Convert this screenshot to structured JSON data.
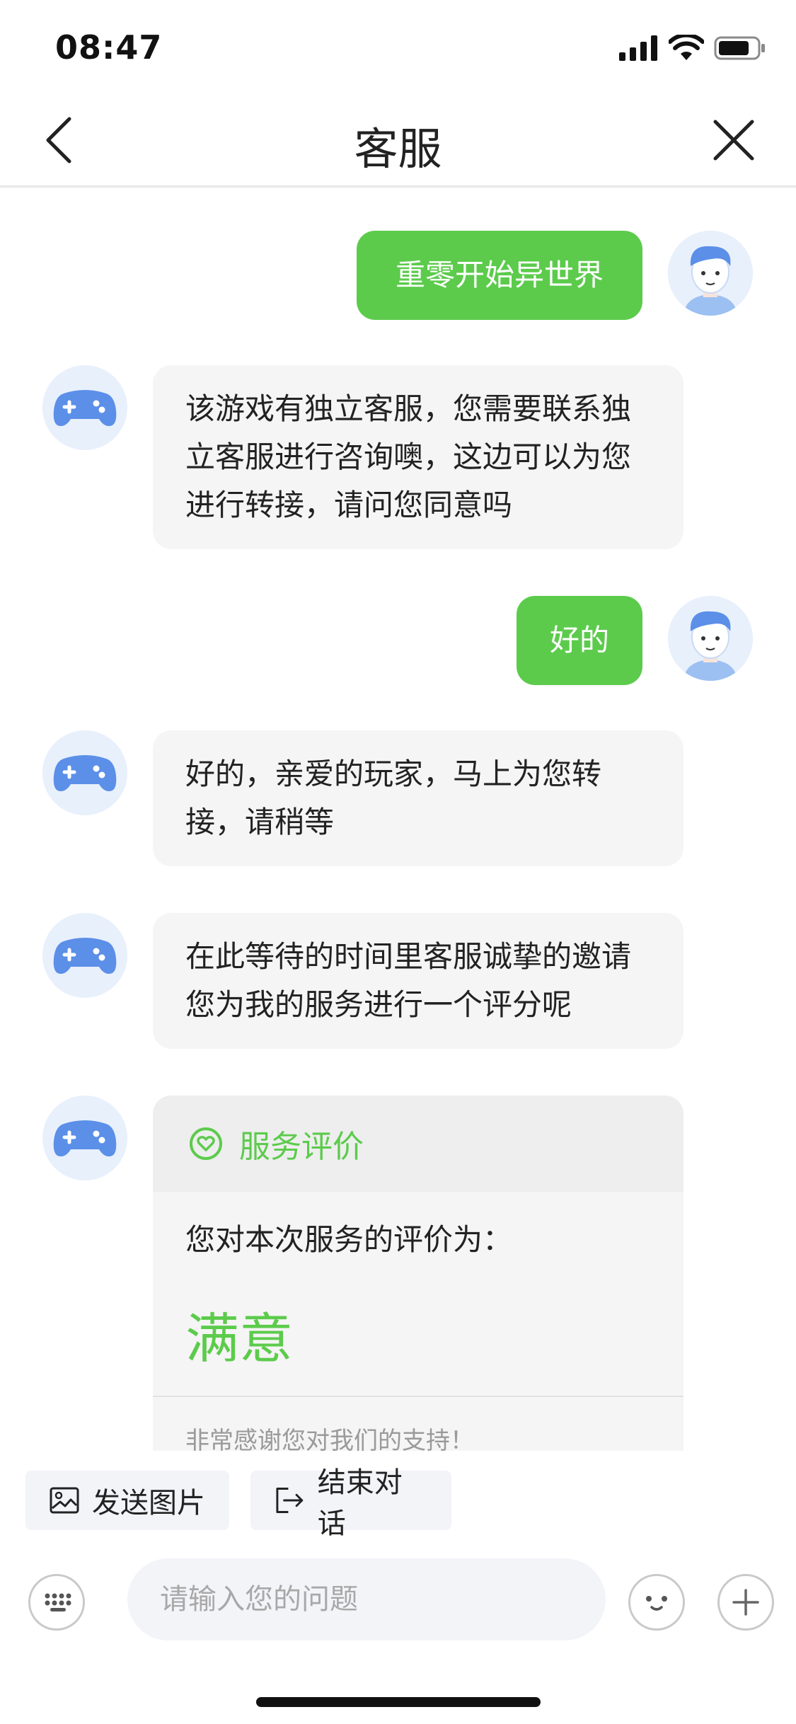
{
  "status_bar": {
    "time": "08:47"
  },
  "nav": {
    "title": "客服"
  },
  "messages": [
    {
      "from": "user",
      "text": "重零开始异世界"
    },
    {
      "from": "bot",
      "text": "该游戏有独立客服，您需要联系独立客服进行咨询噢，这边可以为您进行转接，请问您同意吗"
    },
    {
      "from": "user",
      "text": "好的"
    },
    {
      "from": "bot",
      "text": "好的，亲爱的玩家，马上为您转接，请稍等"
    },
    {
      "from": "bot",
      "text": "在此等待的时间里客服诚挚的邀请您为我的服务进行一个评分呢"
    }
  ],
  "rating_card": {
    "title": "服务评价",
    "question": "您对本次服务的评价为：",
    "value": "满意",
    "thanks": "非常感谢您对我们的支持！"
  },
  "quick_actions": {
    "send_image": "发送图片",
    "end_chat": "结束对话"
  },
  "input": {
    "placeholder": "请输入您的问题"
  },
  "colors": {
    "accent": "#5ccb4c",
    "bot_icon": "#5b8fe8",
    "avatar_bg": "#e8f0fc"
  }
}
